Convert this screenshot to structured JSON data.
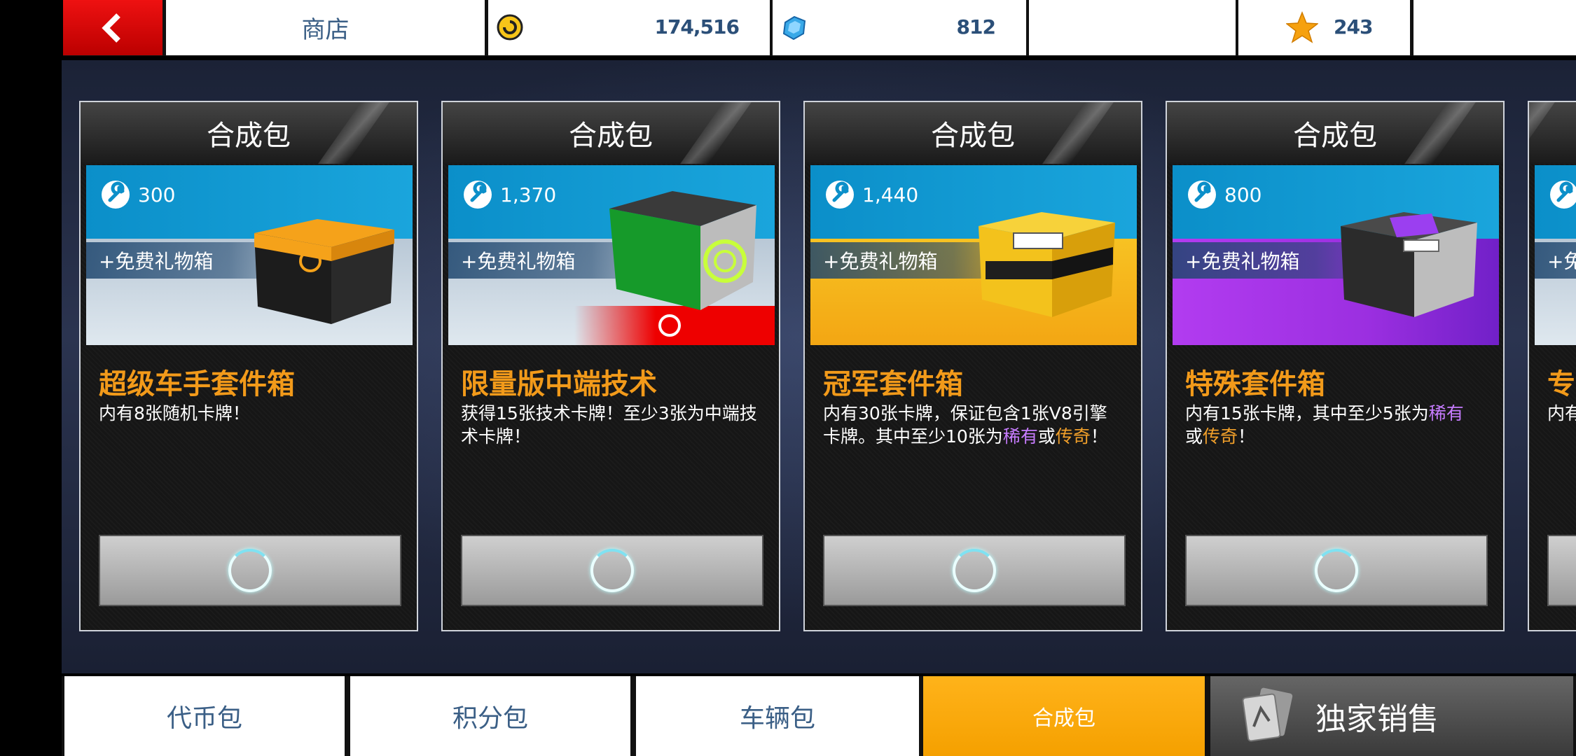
{
  "header": {
    "back_label": "",
    "store_title": "商店",
    "coins": "174,516",
    "gems": "812",
    "stars": "243"
  },
  "cards": [
    {
      "header": "合成包",
      "cost": "300",
      "free_gift": "+免费礼物箱",
      "title": "超级车手套件箱",
      "desc": "内有8张随机卡牌！",
      "banner": "silver",
      "chest_color": "#f5a21a"
    },
    {
      "header": "合成包",
      "cost": "1,370",
      "free_gift": "+免费礼物箱",
      "title": "限量版中端技术",
      "desc": "获得15张技术卡牌！至少3张为中端技术卡牌！",
      "banner": "silver",
      "chest_color": "#1fa82f",
      "limited_strip": true
    },
    {
      "header": "合成包",
      "cost": "1,440",
      "free_gift": "+免费礼物箱",
      "title": "冠军套件箱",
      "desc_parts": [
        "内有30张卡牌，保证包含1张V8引擎卡牌。其中至少10张为",
        "稀有",
        "或",
        "传奇",
        "！"
      ],
      "banner": "gold",
      "chest_color": "#f3c21c"
    },
    {
      "header": "合成包",
      "cost": "800",
      "free_gift": "+免费礼物箱",
      "title": "特殊套件箱",
      "desc_parts": [
        "内有15张卡牌，其中至少5张为",
        "稀有",
        "",
        "或",
        "传奇",
        "！"
      ],
      "banner": "purple",
      "chest_color": "#9b3ff0"
    },
    {
      "header": "",
      "cost": "",
      "free_gift": "+免",
      "title": "专",
      "desc": "内有"
    }
  ],
  "tabs": [
    {
      "label": "代币包",
      "active": false
    },
    {
      "label": "积分包",
      "active": false
    },
    {
      "label": "车辆包",
      "active": false
    },
    {
      "label": "合成包",
      "active": true
    },
    {
      "label": "独家销售",
      "active": false
    }
  ],
  "colors": {
    "accent_orange": "#f5a000",
    "title_orange": "#f29a1a",
    "rare_purple": "#c77cff",
    "back_red": "#d90000"
  },
  "icons": {
    "back": "chevron-left-icon",
    "coins": "coin-icon",
    "gems": "gem-icon",
    "stars": "star-icon",
    "cost": "wrench-icon",
    "buy": "loading-spinner-icon",
    "exclusive": "cards-icon"
  }
}
